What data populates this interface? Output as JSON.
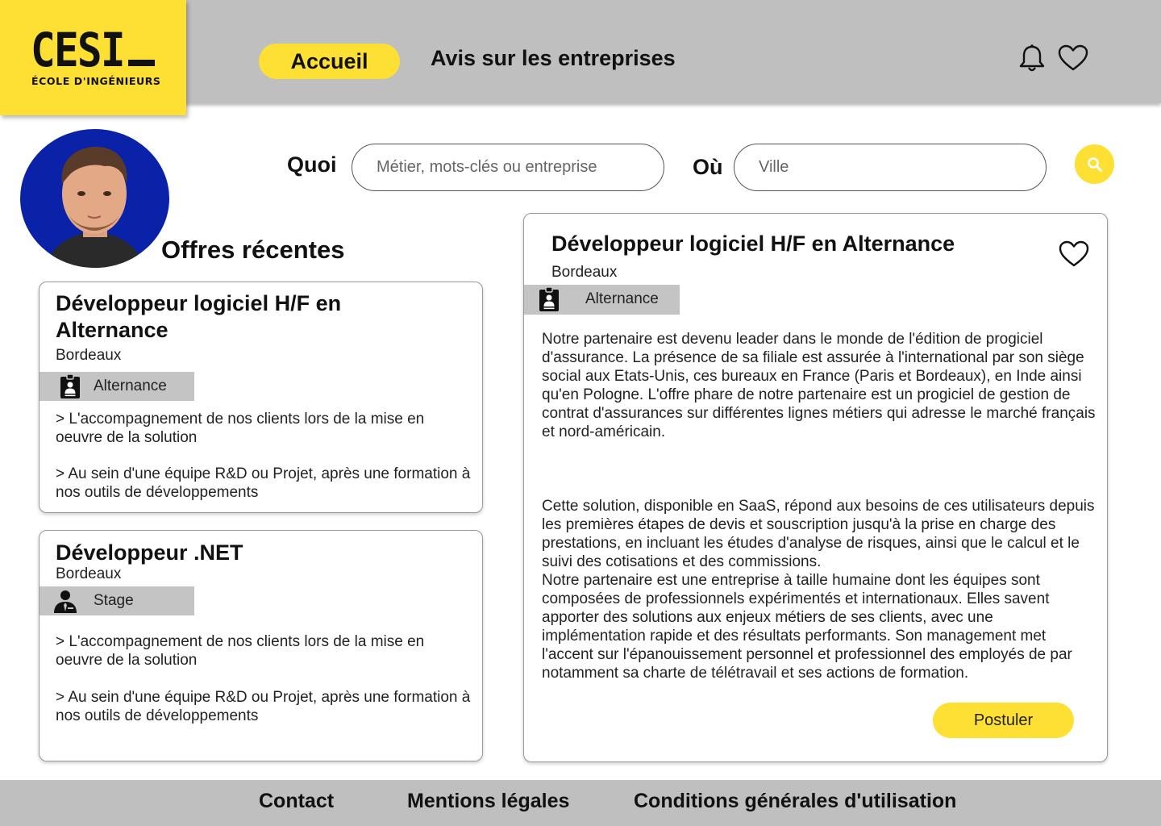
{
  "brand": {
    "name": "CESI",
    "tagline": "ÉCOLE D'INGÉNIEURS",
    "accent": "#fde033"
  },
  "nav": {
    "home_label": "Accueil",
    "reviews_label": "Avis sur les entreprises"
  },
  "header_icons": [
    "bell-icon",
    "heart-icon"
  ],
  "search": {
    "what_label": "Quoi",
    "what_placeholder": "Métier, mots-clés ou entreprise",
    "where_label": "Où",
    "where_placeholder": "Ville",
    "button_icon": "search-icon"
  },
  "recent_title": "Offres récentes",
  "offers": [
    {
      "title_line1": "Développeur logiciel H/F en",
      "title_line2": "Alternance",
      "city": "Bordeaux",
      "type": "Alternance",
      "type_icon": "id-badge-icon",
      "desc1": "> L'accompagnement de nos clients lors de la mise en oeuvre de la solution",
      "desc2": "> Au sein d'une équipe R&D ou Projet, après une formation à nos outils de développements"
    },
    {
      "title_line1": "Développeur .NET",
      "city": "Bordeaux",
      "type": "Stage",
      "type_icon": "business-person-icon",
      "desc1": "> L'accompagnement de nos clients lors de la mise en oeuvre de la solution",
      "desc2": "> Au sein d'une équipe R&D ou Projet, après une formation à nos outils de développements"
    }
  ],
  "detail": {
    "title": "Développeur logiciel H/F en Alternance",
    "city": "Bordeaux",
    "type": "Alternance",
    "paragraph1": "Notre partenaire est devenu leader dans le monde de l'édition de progiciel d'assurance. La présence de sa filiale est assurée à l'international par son siège social aux Etats-Unis, ces bureaux en France (Paris et Bordeaux), en Inde ainsi qu'en Pologne. L'offre phare de notre partenaire est un progiciel de gestion de contrat d'assurances sur différentes lignes métiers qui adresse le marché français et nord-américain.",
    "paragraph2": "Cette solution, disponible en SaaS, répond aux besoins de ces utilisateurs depuis les premières étapes de devis et souscription jusqu'à la prise en charge des prestations, en incluant les études d'analyse de risques, ainsi que le calcul et le suivi des cotisations et des commissions.",
    "paragraph3": "Notre partenaire est une entreprise à taille humaine dont les équipes sont composées de professionnels expérimentés et internationaux. Elles savent apporter des solutions aux enjeux métiers de ses clients, avec une implémentation rapide et des résultats performants. Son management met l'accent sur l'épanouissement personnel et professionnel des employés de par notamment sa charte de télétravail et ses actions de formation.",
    "apply_label": "Postuler"
  },
  "footer": {
    "contact": "Contact",
    "legal": "Mentions légales",
    "terms": "Conditions générales d'utilisation"
  }
}
